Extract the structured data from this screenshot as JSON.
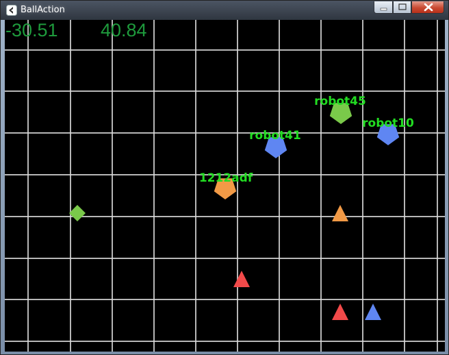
{
  "window": {
    "title": "BallAction"
  },
  "hud": {
    "x": "-30.51",
    "y": "40.84"
  },
  "colors": {
    "label": "#22dd22",
    "orange": "#f29a46",
    "blue": "#5f86f2",
    "green": "#7ac94a",
    "red": "#f24a4a",
    "grid": "#d8d8d8"
  },
  "robots": [
    {
      "label": "1212adf",
      "shape": "pentagon",
      "color": "orange"
    },
    {
      "label": "robot41",
      "shape": "pentagon",
      "color": "blue"
    },
    {
      "label": "robot45",
      "shape": "pentagon",
      "color": "green"
    },
    {
      "label": "robot10",
      "shape": "pentagon",
      "color": "blue"
    }
  ],
  "markers": [
    {
      "shape": "diamond",
      "color": "green"
    },
    {
      "shape": "triangle",
      "color": "orange"
    },
    {
      "shape": "triangle",
      "color": "red"
    },
    {
      "shape": "triangle",
      "color": "red"
    },
    {
      "shape": "triangle",
      "color": "blue"
    }
  ]
}
